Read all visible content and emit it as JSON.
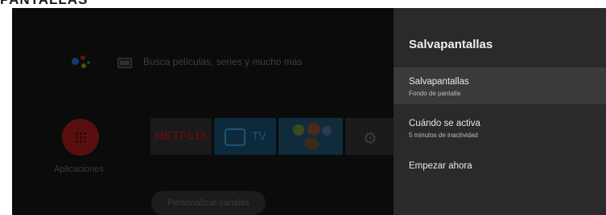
{
  "doc_header": "PANTALLAS",
  "home": {
    "search_hint": "Busca películas, series y mucho más",
    "apps_label": "Aplicaciones",
    "tiles": {
      "netflix": "NETFLIX",
      "tv": "TV"
    },
    "customize_channels": "Personalizar canales"
  },
  "panel": {
    "title": "Salvapantallas",
    "items": [
      {
        "label": "Salvapantallas",
        "sub": "Fondo de pantalla",
        "selected": true
      },
      {
        "label": "Cuándo se activa",
        "sub": "5 minutos de inactividad",
        "selected": false
      },
      {
        "label": "Empezar ahora",
        "sub": "",
        "selected": false
      }
    ]
  },
  "colors": {
    "panel_bg": "#2a2a2a",
    "selected_bg": "#3a3a3a",
    "screen_bg": "#0b0b0b"
  },
  "icons": [
    "google-assistant-icon",
    "keyboard-icon",
    "apps-grid-icon",
    "tv-icon",
    "settings-gear-icon"
  ]
}
